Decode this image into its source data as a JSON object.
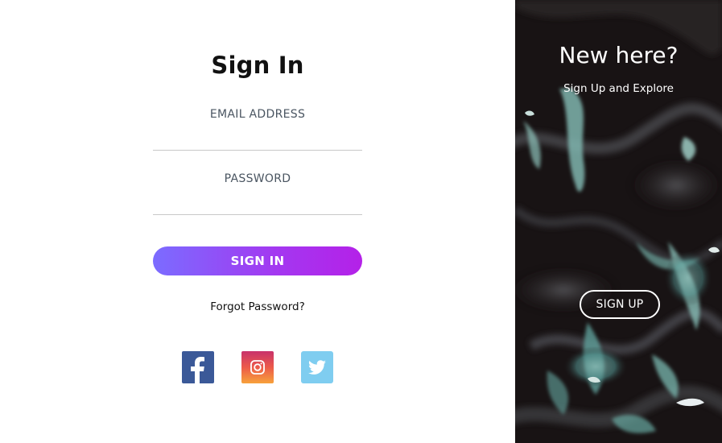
{
  "signin": {
    "title": "Sign In",
    "email_label": "EMAIL ADDRESS",
    "email_value": "",
    "password_label": "PASSWORD",
    "password_value": "",
    "submit_label": "SIGN IN",
    "forgot_label": "Forgot Password?",
    "social": [
      {
        "name": "facebook",
        "icon": "facebook-icon",
        "color": "#3b5998"
      },
      {
        "name": "instagram",
        "icon": "instagram-icon",
        "color": "#e4405f"
      },
      {
        "name": "twitter",
        "icon": "twitter-icon",
        "color": "#7fcdf0"
      }
    ],
    "accent_gradient": [
      "#7b6cff",
      "#b421e8"
    ]
  },
  "signup_panel": {
    "heading": "New here?",
    "subheading": "Sign Up and Explore",
    "button_label": "SIGN UP",
    "background": "dark-marble-teal-image"
  }
}
